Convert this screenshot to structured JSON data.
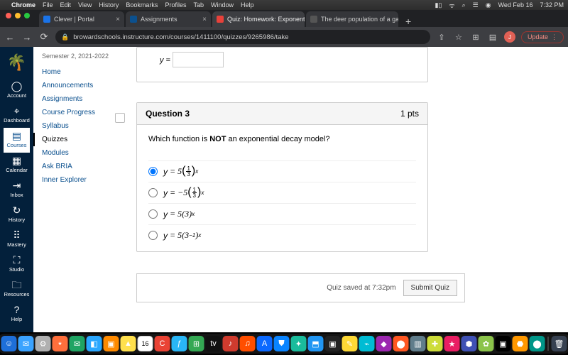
{
  "mac_menu": {
    "app": "Chrome",
    "items": [
      "File",
      "Edit",
      "View",
      "History",
      "Bookmarks",
      "Profiles",
      "Tab",
      "Window",
      "Help"
    ],
    "right": {
      "date": "Wed Feb 16",
      "time": "7:32 PM"
    }
  },
  "browser": {
    "tabs": [
      {
        "label": "Clever | Portal"
      },
      {
        "label": "Assignments"
      },
      {
        "label": "Quiz: Homework: Exponential",
        "active": true
      },
      {
        "label": "The deer population of a game"
      }
    ],
    "new_tab": "+",
    "url": "browardschools.instructure.com/courses/1411100/quizzes/9265986/take",
    "update": "Update"
  },
  "canvas": {
    "logo_text": "🌴",
    "gnav": [
      {
        "icon": "◯",
        "label": "Account"
      },
      {
        "icon": "⌖",
        "label": "Dashboard"
      },
      {
        "icon": "▤",
        "label": "Courses",
        "active": true
      },
      {
        "icon": "▦",
        "label": "Calendar"
      },
      {
        "icon": "⇥",
        "label": "Inbox"
      },
      {
        "icon": "↻",
        "label": "History"
      },
      {
        "icon": "⠿",
        "label": "Mastery"
      },
      {
        "icon": "⛶",
        "label": "Studio"
      },
      {
        "icon": "🗀",
        "label": "Resources"
      },
      {
        "icon": "?",
        "label": "Help"
      }
    ],
    "term": "Semester 2, 2021-2022",
    "cnav": [
      {
        "label": "Home"
      },
      {
        "label": "Announcements"
      },
      {
        "label": "Assignments"
      },
      {
        "label": "Course Progress"
      },
      {
        "label": "Syllabus"
      },
      {
        "label": "Quizzes",
        "active": true
      },
      {
        "label": "Modules"
      },
      {
        "label": "Ask BRIA"
      },
      {
        "label": "Inner Explorer"
      }
    ]
  },
  "quiz": {
    "prev_label": "y =",
    "q_number": "Question 3",
    "points": "1 pts",
    "prompt_pre": "Which function is ",
    "prompt_bold": "NOT",
    "prompt_post": " an exponential decay model?",
    "answers": [
      {
        "html": "y = 5(⅓)ˣ",
        "checked": true
      },
      {
        "html": "y = −5(⅓)ˣ"
      },
      {
        "html": "y = 5(3)ˣ"
      },
      {
        "html": "y = 5(3⁻¹)ˣ"
      }
    ],
    "saved": "Quiz saved at 7:32pm",
    "submit": "Submit Quiz"
  },
  "dock_apps": [
    {
      "c": "#1e6fd9",
      "t": "☺"
    },
    {
      "c": "#3ba3ff",
      "t": "✉"
    },
    {
      "c": "#b0b0b0",
      "t": "⚙"
    },
    {
      "c": "#ff6f3c",
      "t": "⭑"
    },
    {
      "c": "#1fa463",
      "t": "✉"
    },
    {
      "c": "#2aa7ff",
      "t": "◧"
    },
    {
      "c": "#ff8a00",
      "t": "▣"
    },
    {
      "c": "#ffe04d",
      "t": "▲"
    },
    {
      "c": "#ffffff",
      "t": "16"
    },
    {
      "c": "#ea4335",
      "t": "C"
    },
    {
      "c": "#29b6f6",
      "t": "ƒ"
    },
    {
      "c": "#34a853",
      "t": "⊞"
    },
    {
      "c": "#111111",
      "t": "tv"
    },
    {
      "c": "#cf3b2e",
      "t": "♪"
    },
    {
      "c": "#ff4e00",
      "t": "♫"
    },
    {
      "c": "#0b69ff",
      "t": "A"
    },
    {
      "c": "#0a84ff",
      "t": "⛊"
    },
    {
      "c": "#1abc9c",
      "t": "✦"
    },
    {
      "c": "#2196f3",
      "t": "⬒"
    },
    {
      "c": "#222222",
      "t": "▣"
    },
    {
      "c": "#fdd835",
      "t": "✎"
    },
    {
      "c": "#00bcd4",
      "t": "⌁"
    },
    {
      "c": "#9c27b0",
      "t": "◆"
    },
    {
      "c": "#ff5722",
      "t": "⬤"
    },
    {
      "c": "#607d8b",
      "t": "▥"
    },
    {
      "c": "#cddc39",
      "t": "✚"
    },
    {
      "c": "#e91e63",
      "t": "★"
    },
    {
      "c": "#3f51b5",
      "t": "⬢"
    },
    {
      "c": "#8bc34a",
      "t": "✿"
    },
    {
      "c": "#000000",
      "t": "▣"
    },
    {
      "c": "#ff9800",
      "t": "⬣"
    },
    {
      "c": "#009688",
      "t": "⬤"
    },
    {
      "c": "#374151",
      "t": "🗑"
    }
  ]
}
